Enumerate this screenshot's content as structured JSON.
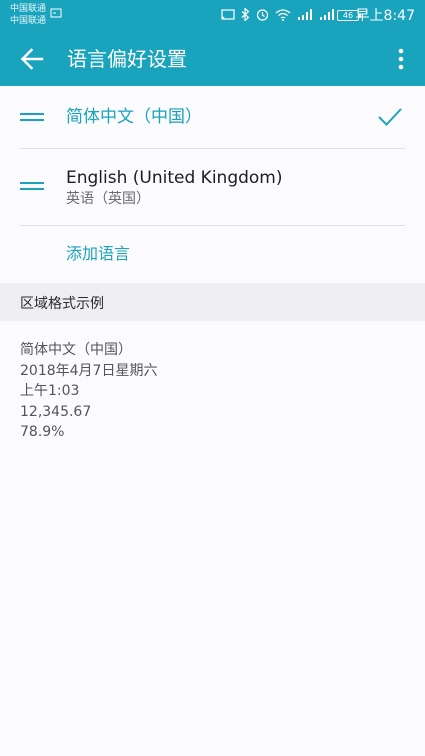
{
  "status_bar": {
    "carrier_1": "中国联通",
    "carrier_2": "中国联通",
    "battery": "46",
    "time": "早上8:47"
  },
  "app_bar": {
    "title": "语言偏好设置",
    "back_icon": "arrow-back-icon",
    "more_icon": "more-vert-icon"
  },
  "languages": [
    {
      "name": "简体中文（中国）",
      "subtitle": "",
      "selected": true
    },
    {
      "name": "English (United Kingdom)",
      "subtitle": "英语（英国）",
      "selected": false
    }
  ],
  "add_language_label": "添加语言",
  "region_format": {
    "title": "区域格式示例",
    "lines": [
      "简体中文（中国）",
      "2018年4月7日星期六",
      "上午1:03",
      "12,345.67",
      "78.9%"
    ]
  },
  "colors": {
    "accent": "#1aa3bc",
    "background": "#fbfafd",
    "section_bg": "#efeff2"
  }
}
